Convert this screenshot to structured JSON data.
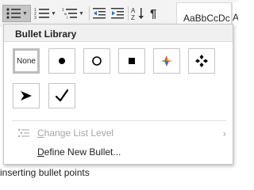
{
  "ribbon": {
    "styles_preview": "AaBbCcDc",
    "styles_preview_2": "A",
    "buttons": [
      {
        "name": "bullets-button",
        "icon": "bullet-list-icon"
      },
      {
        "name": "numbering-button",
        "icon": "numbered-list-icon"
      },
      {
        "name": "multilevel-list-button",
        "icon": "multilevel-list-icon"
      },
      {
        "name": "decrease-indent-button",
        "icon": "decrease-indent-icon"
      },
      {
        "name": "increase-indent-button",
        "icon": "increase-indent-icon"
      },
      {
        "name": "sort-button",
        "icon": "sort-az-icon"
      },
      {
        "name": "show-formatting-button",
        "icon": "pilcrow-icon"
      }
    ]
  },
  "menu": {
    "title": "Bullet Library",
    "bullets": [
      {
        "label": "None",
        "icon": "none",
        "selected": true
      },
      {
        "icon": "filled-circle-icon"
      },
      {
        "icon": "hollow-circle-icon"
      },
      {
        "icon": "filled-square-icon"
      },
      {
        "icon": "four-color-diamond-icon"
      },
      {
        "icon": "four-diamond-icon"
      },
      {
        "icon": "arrowhead-icon"
      },
      {
        "icon": "checkmark-icon"
      }
    ],
    "change_list_level": {
      "pre": "",
      "ul": "C",
      "post": "hange List Level",
      "disabled": true
    },
    "define_new_bullet": {
      "pre": "",
      "ul": "D",
      "post": "efine New Bullet..."
    }
  },
  "document": {
    "text": "inserting bullet points"
  },
  "colors": {
    "ribbon_bg": "#f3f3f3",
    "header_bg": "#f0f0f0",
    "disabled_text": "#a6a6a6"
  }
}
